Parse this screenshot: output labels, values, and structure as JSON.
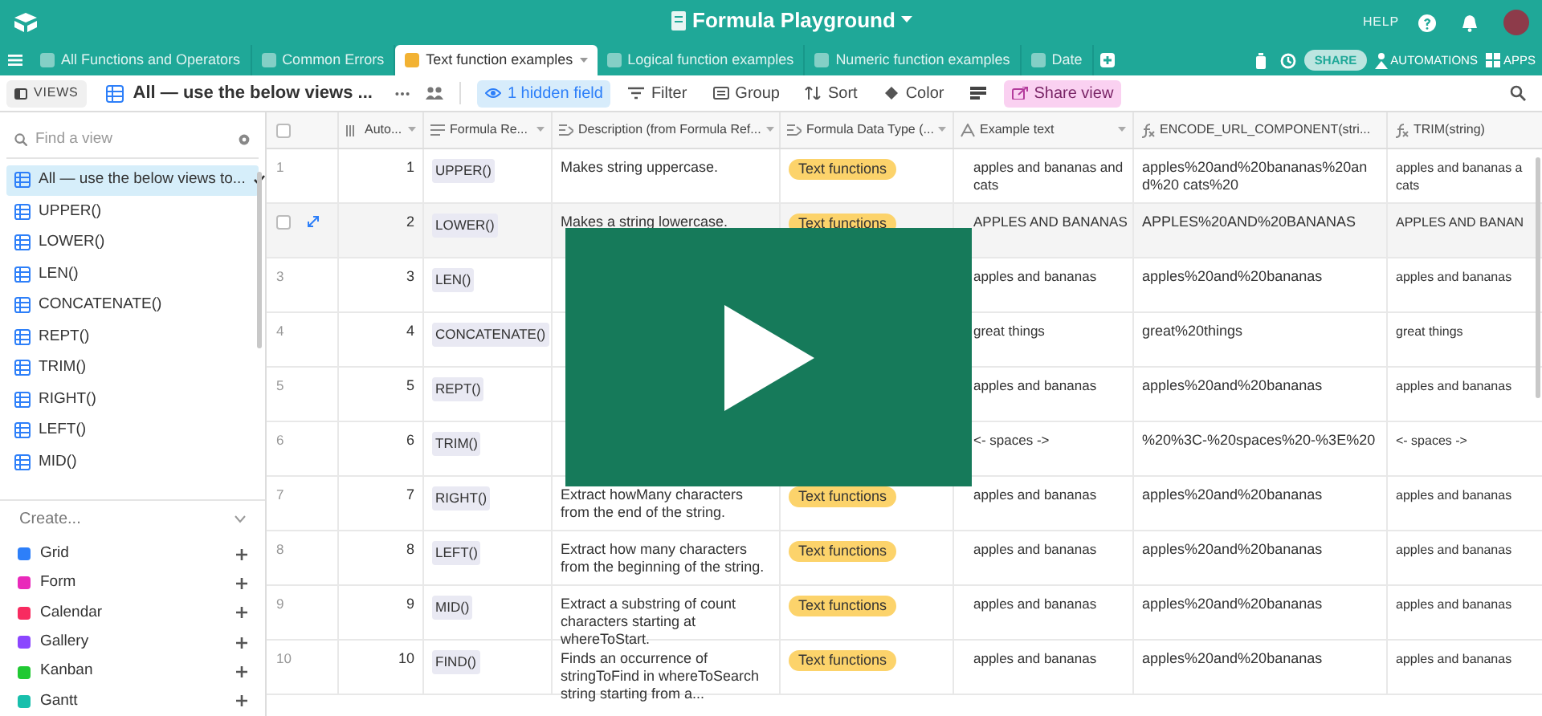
{
  "top_bar": {
    "title": "Formula Playground",
    "help": "HELP"
  },
  "tabs": [
    {
      "label": "All Functions and Operators",
      "selected": false
    },
    {
      "label": "Common Errors",
      "selected": false
    },
    {
      "label": "Text function examples",
      "selected": true
    },
    {
      "label": "Logical function examples",
      "selected": false
    },
    {
      "label": "Numeric function examples",
      "selected": false
    },
    {
      "label": "Date",
      "selected": false
    }
  ],
  "tab_bar_actions": {
    "share": "SHARE",
    "automations": "AUTOMATIONS",
    "apps": "APPS"
  },
  "toolbar": {
    "views_toggle": "VIEWS",
    "view_name": "All — use the below views ...",
    "items": [
      {
        "label": "1 hidden field",
        "kind": "hide"
      },
      {
        "label": "Filter",
        "kind": "filter"
      },
      {
        "label": "Group",
        "kind": "group"
      },
      {
        "label": "Sort",
        "kind": "sort"
      },
      {
        "label": "Color",
        "kind": "color"
      },
      {
        "kind": "density"
      },
      {
        "label": "Share view",
        "kind": "share"
      }
    ]
  },
  "sidebar": {
    "search": {
      "placeholder": "Find a view"
    },
    "views": [
      {
        "label": "All — use the below views to...",
        "selected": true
      },
      {
        "label": "UPPER()",
        "selected": false
      },
      {
        "label": "LOWER()",
        "selected": false
      },
      {
        "label": "LEN()",
        "selected": false
      },
      {
        "label": "CONCATENATE()",
        "selected": false
      },
      {
        "label": "REPT()",
        "selected": false
      },
      {
        "label": "TRIM()",
        "selected": false
      },
      {
        "label": "RIGHT()",
        "selected": false
      },
      {
        "label": "LEFT()",
        "selected": false
      },
      {
        "label": "MID()",
        "selected": false
      }
    ],
    "create_label": "Create...",
    "create_items": [
      {
        "label": "Grid",
        "color": "#2d7ff9"
      },
      {
        "label": "Form",
        "color": "#e929ba"
      },
      {
        "label": "Calendar",
        "color": "#f82b60"
      },
      {
        "label": "Gallery",
        "color": "#8b46ff"
      },
      {
        "label": "Kanban",
        "color": "#20c933"
      },
      {
        "label": "Gantt",
        "color": "#18bfac"
      }
    ]
  },
  "table": {
    "select_all_checked": false,
    "columns": [
      {
        "label": "Auto...",
        "kind": "number"
      },
      {
        "label": "Formula Re...",
        "kind": "link"
      },
      {
        "label": "Description (from Formula Ref...",
        "kind": "lookup"
      },
      {
        "label": "Formula Data Type (...",
        "kind": "lookup"
      },
      {
        "label": "Example text",
        "kind": "text"
      },
      {
        "label": "ENCODE_URL_COMPONENT(stri...",
        "kind": "formula"
      },
      {
        "label": "TRIM(string)",
        "kind": "formula"
      }
    ],
    "rows": [
      {
        "row_number": "1",
        "hovered": false,
        "checked": false,
        "auto": "1",
        "formula": "UPPER()",
        "description": "Makes string uppercase.",
        "type": "Text functions",
        "example": "apples and bananas and cats",
        "encoded": "apples%20and%20bananas%20and%20 cats%20",
        "trimmed": "apples and bananas a\ncats"
      },
      {
        "hovered": true,
        "checked": false,
        "auto": "2",
        "formula": "LOWER()",
        "description": "Makes a string lowercase.",
        "type": "Text functions",
        "example": "APPLES AND BANANAS",
        "encoded": "APPLES%20AND%20BANANAS",
        "trimmed": "APPLES AND BANAN"
      },
      {
        "row_number": "3",
        "hovered": false,
        "checked": false,
        "auto": "3",
        "formula": "LEN()",
        "example": "apples and bananas",
        "encoded": "apples%20and%20bananas",
        "trimmed": "apples and bananas"
      },
      {
        "row_number": "4",
        "hovered": false,
        "checked": false,
        "auto": "4",
        "formula": "CONCATENATE()",
        "example": "great things",
        "encoded": "great%20things",
        "trimmed": "great things"
      },
      {
        "row_number": "5",
        "hovered": false,
        "checked": false,
        "auto": "5",
        "formula": "REPT()",
        "example": "apples and bananas",
        "encoded": "apples%20and%20bananas",
        "trimmed": "apples and bananas"
      },
      {
        "row_number": "6",
        "hovered": false,
        "checked": false,
        "auto": "6",
        "formula": "TRIM()",
        "example": " <- spaces -> ",
        "encoded": "%20%3C-%20spaces%20-%3E%20",
        "trimmed": "<- spaces ->"
      },
      {
        "row_number": "7",
        "hovered": false,
        "checked": false,
        "auto": "7",
        "formula": "RIGHT()",
        "description": "Extract howMany characters from the end of the string.",
        "type": "Text functions",
        "example": "apples and bananas",
        "encoded": "apples%20and%20bananas",
        "trimmed": "apples and bananas"
      },
      {
        "row_number": "8",
        "hovered": false,
        "checked": false,
        "auto": "8",
        "formula": "LEFT()",
        "description": "Extract how many characters from the beginning of the string.",
        "type": "Text functions",
        "example": "apples and bananas",
        "encoded": "apples%20and%20bananas",
        "trimmed": "apples and bananas"
      },
      {
        "row_number": "9",
        "hovered": false,
        "checked": false,
        "auto": "9",
        "formula": "MID()",
        "description": "Extract a substring of count characters starting at whereToStart.",
        "type": "Text functions",
        "example": "apples and bananas",
        "encoded": "apples%20and%20bananas",
        "trimmed": "apples and bananas"
      },
      {
        "row_number": "10",
        "hovered": false,
        "checked": false,
        "auto": "10",
        "formula": "FIND()",
        "description": "Finds an occurrence of stringToFind in whereToSearch string starting from a...",
        "type": "Text functions",
        "example": "apples and bananas",
        "encoded": "apples%20and%20bananas",
        "trimmed": "apples and bananas"
      }
    ]
  }
}
